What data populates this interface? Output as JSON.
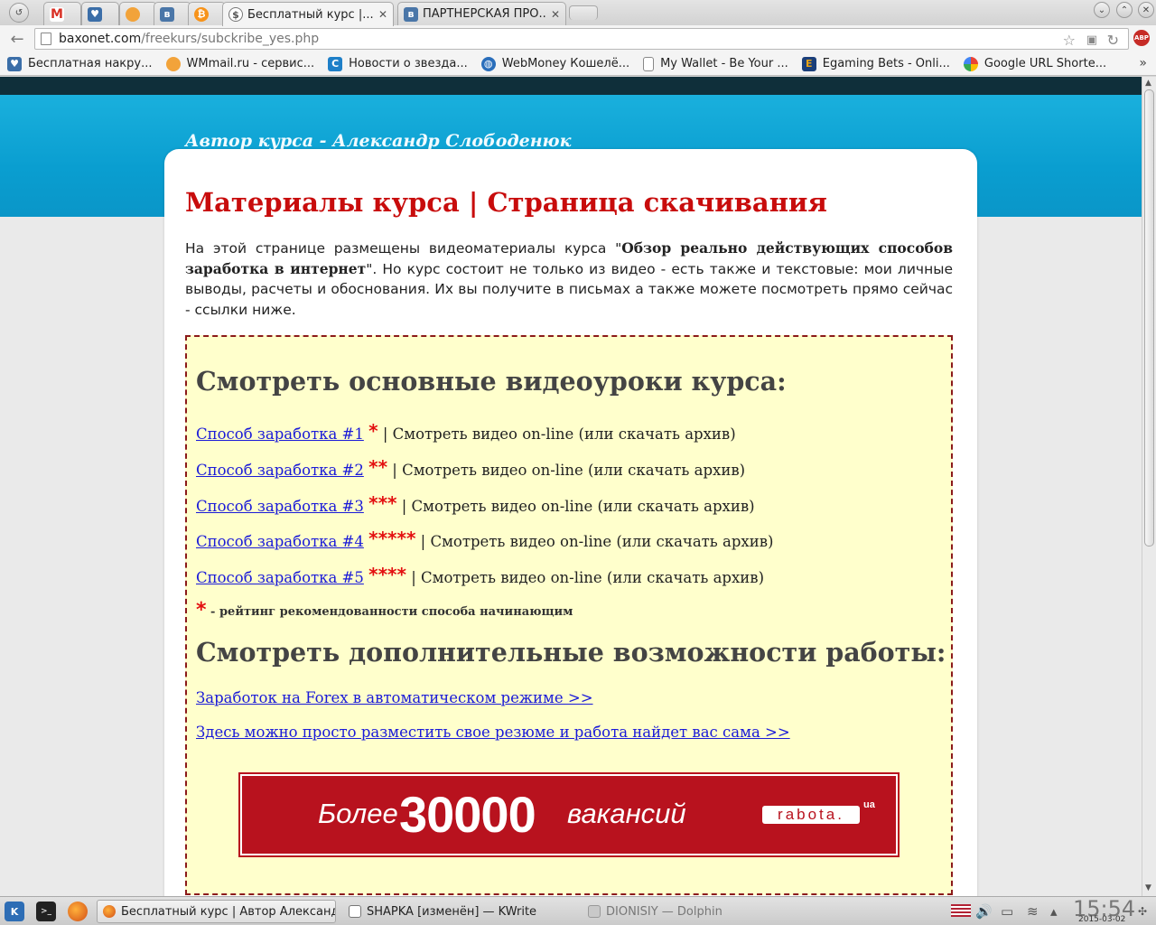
{
  "browser": {
    "tabs": [
      {
        "title": "",
        "icon": "gmail-icon",
        "color": "#d93025"
      },
      {
        "title": "",
        "icon": "heart-icon",
        "color": "#3b6ea8"
      },
      {
        "title": "",
        "icon": "webmoney-icon",
        "color": "#f2a33a"
      },
      {
        "title": "",
        "icon": "vk-icon",
        "color": "#4a76a8"
      },
      {
        "title": "",
        "icon": "bitcoin-icon",
        "color": "#f7931a"
      },
      {
        "title": "Бесплатный курс |...",
        "icon": "dollar-icon",
        "color": "#6d6d6d"
      },
      {
        "title": "ПАРТНЕРСКАЯ ПРО...",
        "icon": "vk-icon",
        "color": "#4a76a8"
      }
    ],
    "url_host": "baxonet.com",
    "url_path": "/freekurs/subckribe_yes.php",
    "bookmarks": [
      {
        "label": "Бесплатная накру...",
        "icon": "heart-icon",
        "color": "#3b6ea8"
      },
      {
        "label": "WMmail.ru - сервис...",
        "icon": "wmmail-icon",
        "color": "#f2a33a"
      },
      {
        "label": "Новости о звезда...",
        "icon": "c-icon",
        "color": "#1e7fc8"
      },
      {
        "label": "WebMoney Кошелё...",
        "icon": "globe-icon",
        "color": "#2a6ebb"
      },
      {
        "label": "My Wallet - Be Your ...",
        "icon": "page-icon",
        "color": "#ffffff"
      },
      {
        "label": "Egaming Bets - Onli...",
        "icon": "e-icon",
        "color": "#e8a317"
      },
      {
        "label": "Google URL Shorte...",
        "icon": "google-icon",
        "color": "#34a853"
      }
    ]
  },
  "page": {
    "author": "Автор курса - Александр Слободенюк",
    "title": "Материалы курса | Страница скачивания",
    "intro_before": "На этой странице размещены видеоматериалы курса \"",
    "intro_bold": "Обзор реально действующих способов заработка в интернет",
    "intro_after": "\". Но курс состоит не только из видео - есть также и текстовые: мои личные выводы, расчеты и обоснования. Их вы получите в письмах а также можете посмотреть прямо сейчас - ссылки ниже.",
    "section1": "Смотреть основные видеоуроки курса:",
    "lessons": [
      {
        "link": "Способ заработка #1",
        "stars": "*",
        "rest": " | Смотреть видео on-line (или скачать архив)"
      },
      {
        "link": "Способ заработка #2",
        "stars": "**",
        "rest": " | Смотреть видео on-line (или скачать архив)"
      },
      {
        "link": "Способ заработка #3",
        "stars": "***",
        "rest": " | Смотреть видео on-line (или скачать архив)"
      },
      {
        "link": "Способ заработка #4",
        "stars": "*****",
        "rest": " | Смотреть видео on-line (или скачать архив)"
      },
      {
        "link": "Способ заработка #5",
        "stars": "****",
        "rest": " | Смотреть видео on-line (или скачать архив)"
      }
    ],
    "note_star": "*",
    "note": " - рейтинг рекомендованности способа начинающим",
    "section2": "Смотреть дополнительные возможности работы:",
    "extra_links": [
      "Заработок на Forex в автоматическом режиме >>",
      "Здесь можно просто разместить свое резюме и работа найдет вас сама >>"
    ],
    "banner": {
      "before": "Более",
      "number": "30000",
      "after": "вакансий",
      "logo": "rabota.",
      "logo_suffix": "ua"
    }
  },
  "taskbar": {
    "tasks": [
      {
        "label": "Бесплатный курс | Автор Александр",
        "state": "active"
      },
      {
        "label": "SHAPKA [изменён] — KWrite",
        "state": "normal"
      },
      {
        "label": "DIONISIY — Dolphin",
        "state": "dim"
      }
    ],
    "time": "15:54",
    "date": "2015-03-02"
  },
  "colors": {
    "header": "#0a9ed0",
    "title_red": "#c80c0c",
    "box_bg": "#ffffcc",
    "box_border": "#8b1a1a",
    "link": "#1a1ad8",
    "banner_red": "#b8121e"
  }
}
